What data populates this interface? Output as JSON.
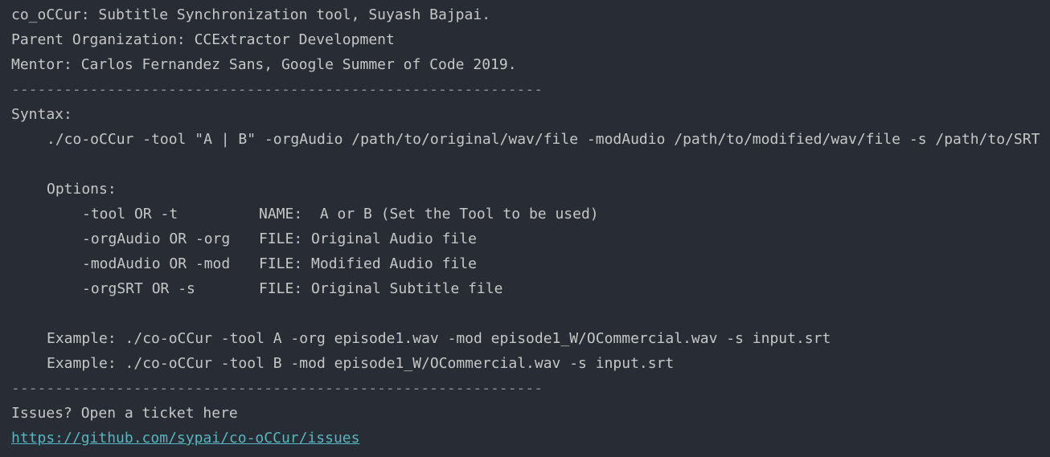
{
  "header": {
    "title_line": "co_oCCur: Subtitle Synchronization tool, Suyash Bajpai.",
    "org_line": "Parent Organization: CCExtractor Development",
    "mentor_line": "Mentor: Carlos Fernandez Sans, Google Summer of Code 2019."
  },
  "rule": "-------------------------------------------------------------",
  "syntax": {
    "label": "Syntax:",
    "command": "./co-oCCur -tool \"A | B\" -orgAudio /path/to/original/wav/file -modAudio /path/to/modified/wav/file -s /path/to/SRT"
  },
  "options": {
    "label": "Options:",
    "items": [
      {
        "flag": "-tool OR -t",
        "desc": "NAME:  A or B (Set the Tool to be used)"
      },
      {
        "flag": "-orgAudio OR -org",
        "desc": "FILE: Original Audio file"
      },
      {
        "flag": "-modAudio OR -mod",
        "desc": "FILE: Modified Audio file"
      },
      {
        "flag": "-orgSRT OR -s",
        "desc": "FILE: Original Subtitle file"
      }
    ]
  },
  "examples": [
    "Example: ./co-oCCur -tool A -org episode1.wav -mod episode1_W/OCommercial.wav -s input.srt",
    "Example: ./co-oCCur -tool B -mod episode1_W/OCommercial.wav -s input.srt"
  ],
  "footer": {
    "issues_text": "Issues? Open a ticket here",
    "issues_url": "https://github.com/sypai/co-oCCur/issues"
  },
  "colors": {
    "background": "#282c34",
    "text": "#c5c8c6",
    "link": "#56b6c2"
  }
}
